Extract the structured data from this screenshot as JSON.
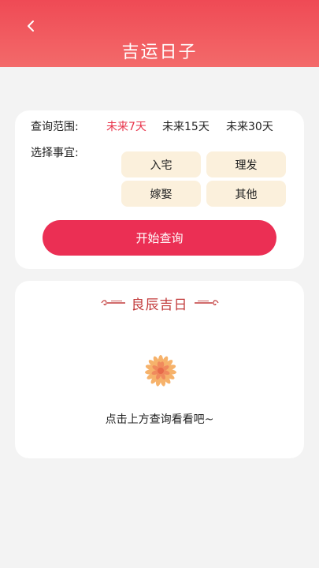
{
  "header": {
    "title": "吉运日子",
    "back_icon": "chevron-left-icon",
    "gradient_colors": [
      "#ef4a55",
      "#f36a6a"
    ]
  },
  "query": {
    "range_label": "查询范围:",
    "range_options": [
      {
        "label": "未来7天",
        "selected": true
      },
      {
        "label": "未来15天",
        "selected": false
      },
      {
        "label": "未来30天",
        "selected": false
      }
    ],
    "matter_label": "选择事宜:",
    "matters": [
      "入宅",
      "理发",
      "嫁娶",
      "其他"
    ],
    "start_button": "开始查询",
    "accent_color": "#eb2f54",
    "chip_color": "#fbf0dc"
  },
  "results": {
    "title": "良辰吉日",
    "title_color": "#c23b3b",
    "empty_icon": "chrysanthemum-icon",
    "empty_text": "点击上方查询看看吧~"
  }
}
